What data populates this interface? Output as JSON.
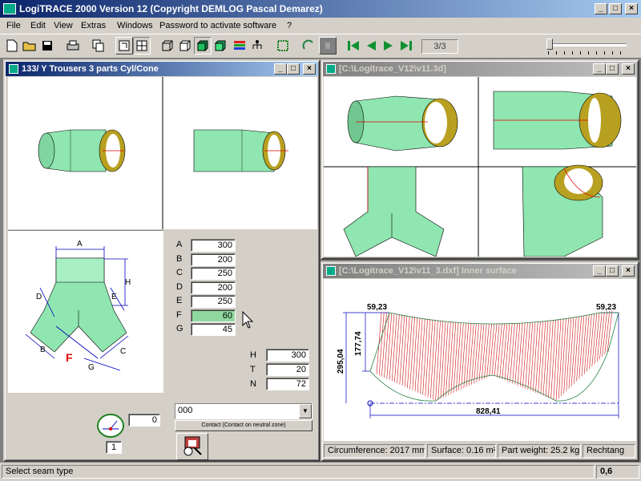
{
  "app": {
    "title": "LogiTRACE 2000  Version 12  (Copyright DEMLOG Pascal Demarez)"
  },
  "menu": [
    "File",
    "Edit",
    "View",
    "Extras",
    "Windows",
    "Password to activate software",
    "?"
  ],
  "toolbar": {
    "page_counter": "3/3"
  },
  "colors": {
    "title_active": "#0a246a",
    "pipe": "#8fe6b0",
    "dim": "#0000c0",
    "hatch": "#d01010"
  },
  "param_window": {
    "title": "133/ Y Trousers 3 parts Cyl/Cone",
    "params": [
      {
        "label": "A",
        "value": "300"
      },
      {
        "label": "B",
        "value": "200"
      },
      {
        "label": "C",
        "value": "250"
      },
      {
        "label": "D",
        "value": "200"
      },
      {
        "label": "E",
        "value": "250"
      },
      {
        "label": "F",
        "value": "60"
      },
      {
        "label": "G",
        "value": "45"
      }
    ],
    "extra": [
      {
        "label": "H",
        "value": "300"
      },
      {
        "label": "T",
        "value": "20"
      },
      {
        "label": "N",
        "value": "72"
      }
    ],
    "diagram_labels": {
      "A": "A",
      "B": "B",
      "C": "C",
      "D": "D",
      "E": "E",
      "F": "F",
      "G": "G",
      "H": "H"
    },
    "angle_value": "0",
    "seam_index": "1",
    "combo_value": "000",
    "contact_button": "Contact (Contact on neutral zone)"
  },
  "view3d_window": {
    "title": "[C:\\Logitrace_V12\\v11.3d]"
  },
  "dxf_window": {
    "title": "[C:\\Logitrace_V12\\v11_3.dxf]  Inner surface",
    "dims": {
      "top_left": "59,23",
      "top_right": "59,23",
      "h1": "177,74",
      "h2": "295,04",
      "width": "828,41"
    },
    "status": [
      {
        "label": "Circumference: 2017 mm"
      },
      {
        "label": "Surface: 0.16 m²"
      },
      {
        "label": "Part weight: 25.2 kg"
      },
      {
        "label": "Rechtang"
      }
    ]
  },
  "statusbar": {
    "message": "Select seam type",
    "value": "0,6"
  }
}
